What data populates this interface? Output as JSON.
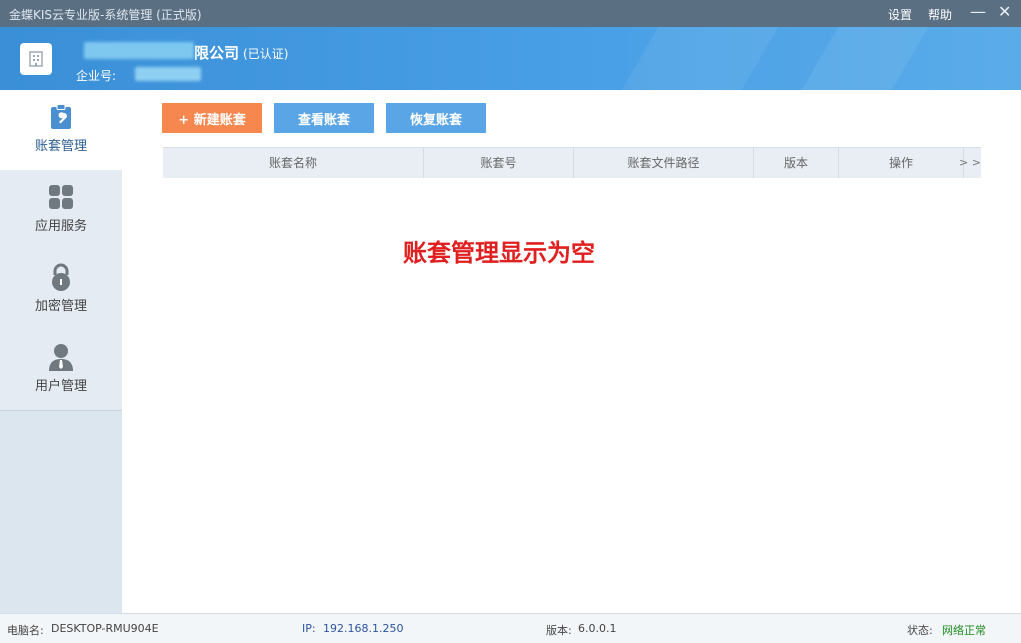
{
  "window": {
    "title": "金蝶KIS云专业版-系统管理 (正式版)",
    "settings_label": "设置",
    "help_label": "帮助",
    "minimize_glyph": "—",
    "close_glyph": "✕"
  },
  "header": {
    "company_suffix": "限公司",
    "verified_label": "(已认证)",
    "enterprise_label": "企业号:"
  },
  "sidebar": {
    "items": [
      {
        "label": "账套管理",
        "icon": "clipboard-wrench-icon",
        "active": true
      },
      {
        "label": "应用服务",
        "icon": "apps-grid-icon",
        "active": false
      },
      {
        "label": "加密管理",
        "icon": "lock-icon",
        "active": false
      },
      {
        "label": "用户管理",
        "icon": "user-icon",
        "active": false
      }
    ]
  },
  "toolbar": {
    "new_label": "+ 新建账套",
    "view_label": "查看账套",
    "restore_label": "恢复账套"
  },
  "grid": {
    "columns": [
      "账套名称",
      "账套号",
      "账套文件路径",
      "版本",
      "操作"
    ],
    "more_label": "> >"
  },
  "annotation": "账套管理显示为空",
  "status": {
    "computer_label": "电脑名:",
    "computer_value": "DESKTOP-RMU904E",
    "ip_label": "IP:",
    "ip_value": "192.168.1.250",
    "version_label": "版本:",
    "version_value": "6.0.0.1",
    "state_label": "状态:",
    "state_value": "网络正常"
  },
  "colors": {
    "accent_blue": "#4aa0e6",
    "orange": "#f5874f",
    "annotation_red": "#e02020",
    "ok_green": "#1e8a1e"
  }
}
